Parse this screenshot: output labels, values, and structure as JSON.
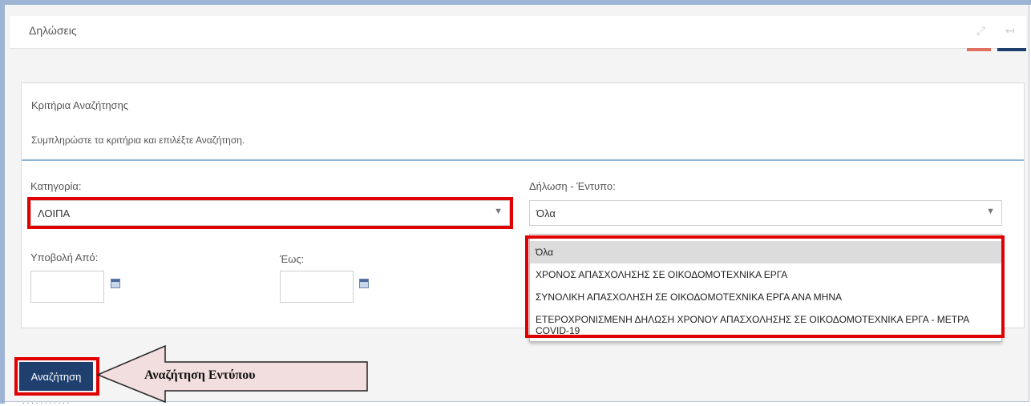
{
  "header": {
    "title": "Δηλώσεις",
    "icons": [
      "expand-icon",
      "collapse-icon"
    ]
  },
  "panel": {
    "title": "Κριτήρια Αναζήτησης",
    "subtitle": "Συμπληρώστε τα κριτήρια και επιλέξτε Αναζήτηση."
  },
  "filters": {
    "category_label": "Κατηγορία:",
    "category_value": "ΛΟΙΠΑ",
    "form_label": "Δήλωση - Έντυπο:",
    "form_value": "Όλα",
    "from_label": "Υποβολή Από:",
    "to_label": "Έως:"
  },
  "dropdown": {
    "options": [
      "Όλα",
      "ΧΡΟΝΟΣ ΑΠΑΣΧΟΛΗΣΗΣ ΣΕ ΟΙΚΟΔΟΜΟΤΕΧΝΙΚΑ ΕΡΓΑ",
      "ΣΥΝΟΛΙΚΗ ΑΠΑΣΧΟΛΗΣΗ ΣΕ ΟΙΚΟΔΟΜΟΤΕΧΝΙΚΑ ΕΡΓΑ ΑΝΑ ΜΗΝΑ",
      "ΕΤΕΡΟΧΡΟΝΙΣΜΕΝΗ ΔΗΛΩΣΗ ΧΡΟΝΟΥ ΑΠΑΣΧΟΛΗΣΗΣ ΣΕ ΟΙΚΟΔΟΜΟΤΕΧΝΙΚΑ ΕΡΓΑ - ΜΕΤΡΑ COVID-19"
    ]
  },
  "actions": {
    "search_label": "Αναζήτηση"
  },
  "annotation": {
    "callout_text": "Αναζήτηση Εντύπου"
  },
  "colors": {
    "accent": "#1f3f6e",
    "highlight": "#e00000",
    "callout_fill": "#f2dede"
  }
}
